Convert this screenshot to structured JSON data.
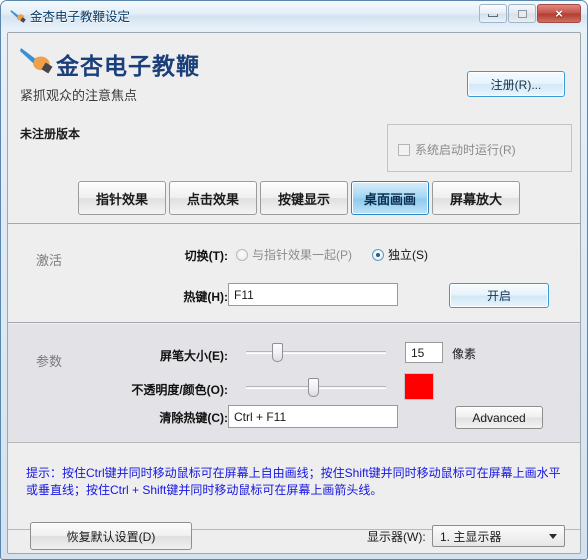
{
  "window": {
    "title": "金杏电子教鞭设定",
    "title_icon": "pen-brush-icon",
    "controls": {
      "minimize": "minimize-icon",
      "maximize": "maximize-icon",
      "close": "×"
    }
  },
  "header": {
    "logo_icon": "pen-brush-logo",
    "product_title": "金杏电子教鞭",
    "tagline": "紧抓观众的注意焦点",
    "license_status": "未注册版本",
    "register_label": "注册(R)...",
    "autostart": {
      "label": "系统启动时运行(R)",
      "checked": false,
      "enabled": false
    }
  },
  "tabs": [
    {
      "label": "指针效果",
      "active": false
    },
    {
      "label": "点击效果",
      "active": false
    },
    {
      "label": "按键显示",
      "active": false
    },
    {
      "label": "桌面画画",
      "active": true
    },
    {
      "label": "屏幕放大",
      "active": false
    }
  ],
  "activation": {
    "section_label": "激活",
    "switch_label": "切换(T):",
    "radio_together": "与指针效果一起(P)",
    "radio_standalone": "独立(S)",
    "selected": "独立(S)",
    "hotkey_label": "热键(H):",
    "hotkey_value": "F11",
    "hotkey_placeholder": "",
    "start_label": "开启"
  },
  "parameters": {
    "section_label": "参数",
    "pen_size_label": "屏笔大小(E):",
    "pen_size_value": "15",
    "pen_size_unit": "像素",
    "pen_size_percent": 20,
    "opacity_label": "不透明度/颜色(O):",
    "opacity_percent": 48,
    "color_hex": "#fe0000",
    "clear_hotkey_label": "清除热键(C):",
    "clear_hotkey_value": "Ctrl + F11",
    "advanced_label": "Advanced"
  },
  "hint": {
    "text": "提示：按住Ctrl键并同时移动鼠标可在屏幕上自由画线；按住Shift键并同时移动鼠标可在屏幕上画水平或垂直线；按住Ctrl + Shift键并同时移动鼠标可在屏幕上画箭头线。",
    "color": "#1616e0"
  },
  "footer": {
    "restore_defaults_label": "恢复默认设置(D)",
    "monitor_label": "显示器(W):",
    "monitor_selected": "1. 主显示器",
    "monitor_options": [
      "1. 主显示器"
    ]
  }
}
